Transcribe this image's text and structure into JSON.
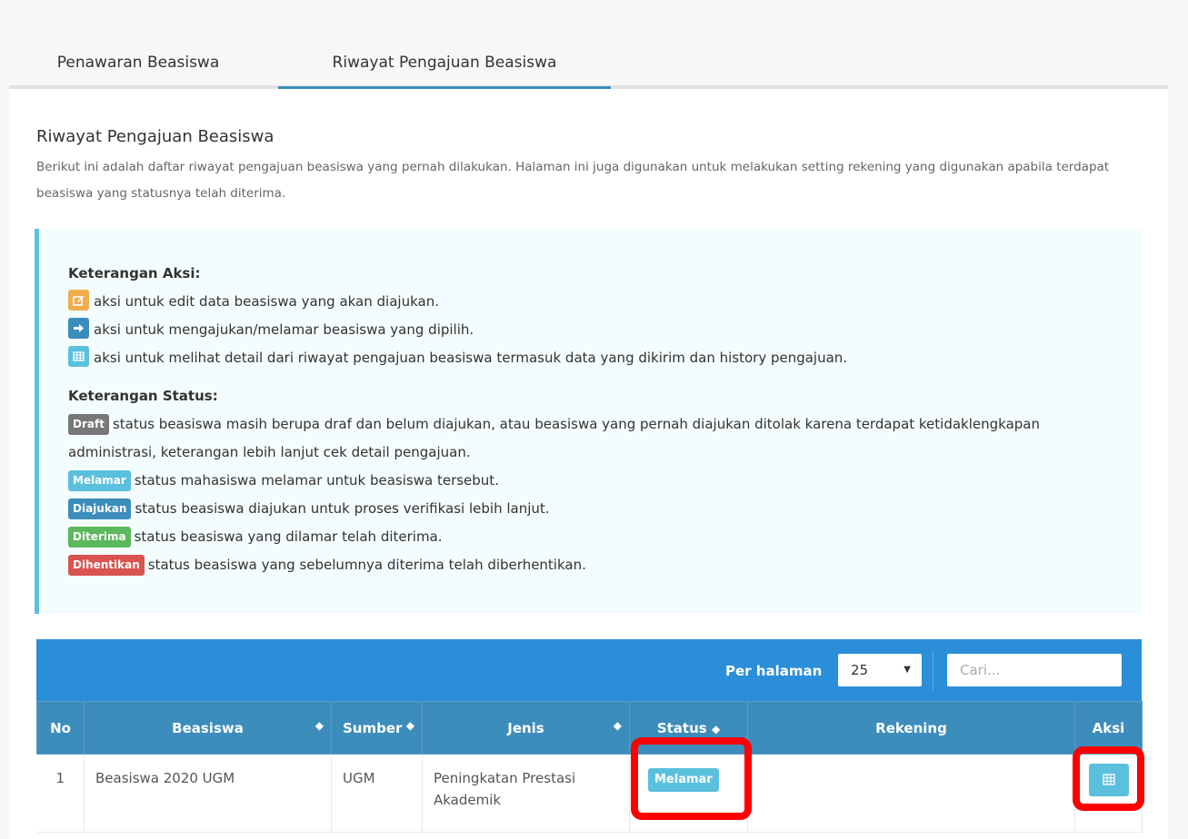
{
  "tabs": [
    {
      "label": "Penawaran Beasiswa"
    },
    {
      "label": "Riwayat Pengajuan Beasiswa"
    }
  ],
  "section": {
    "title": "Riwayat Pengajuan Beasiswa",
    "description": "Berikut ini adalah daftar riwayat pengajuan beasiswa yang pernah dilakukan. Halaman ini juga digunakan untuk melakukan setting rekening yang digunakan apabila terdapat beasiswa yang statusnya telah diterima."
  },
  "legend": {
    "aksi_title": "Keterangan Aksi:",
    "aksi": [
      {
        "icon": "edit-icon",
        "color": "#f0ad4e",
        "text": "aksi untuk edit data beasiswa yang akan diajukan."
      },
      {
        "icon": "arrow-right-icon",
        "color": "#3c8dbc",
        "text": "aksi untuk mengajukan/melamar beasiswa yang dipilih."
      },
      {
        "icon": "table-icon",
        "color": "#5bc0de",
        "text": "aksi untuk melihat detail dari riwayat pengajuan beasiswa termasuk data yang dikirim dan history pengajuan."
      }
    ],
    "status_title": "Keterangan Status:",
    "status": [
      {
        "badge": "Draft",
        "color": "#777777",
        "text": "status beasiswa masih berupa draf dan belum diajukan, atau beasiswa yang pernah diajukan ditolak karena terdapat ketidaklengkapan administrasi, keterangan lebih lanjut cek detail pengajuan."
      },
      {
        "badge": "Melamar",
        "color": "#5bc0de",
        "text": "status mahasiswa melamar untuk beasiswa tersebut."
      },
      {
        "badge": "Diajukan",
        "color": "#3c8dbc",
        "text": "status beasiswa diajukan untuk proses verifikasi lebih lanjut."
      },
      {
        "badge": "Diterima",
        "color": "#5cb85c",
        "text": "status beasiswa yang dilamar telah diterima."
      },
      {
        "badge": "Dihentikan",
        "color": "#d9534f",
        "text": "status beasiswa yang sebelumnya diterima telah diberhentikan."
      }
    ]
  },
  "table": {
    "per_page_label": "Per halaman",
    "per_page_value": "25",
    "search_placeholder": "Cari...",
    "columns": [
      "No",
      "Beasiswa",
      "Sumber",
      "Jenis",
      "Status",
      "Rekening",
      "Aksi"
    ],
    "rows": [
      {
        "no": "1",
        "beasiswa": "Beasiswa 2020 UGM",
        "sumber": "UGM",
        "jenis": "Peningkatan Prestasi Akademik",
        "status": "Melamar",
        "rekening": ""
      }
    ]
  },
  "colors": {
    "accent": "#3c8dbc",
    "table_toolbar": "#2b8ed8",
    "highlight": "#ff0000"
  }
}
